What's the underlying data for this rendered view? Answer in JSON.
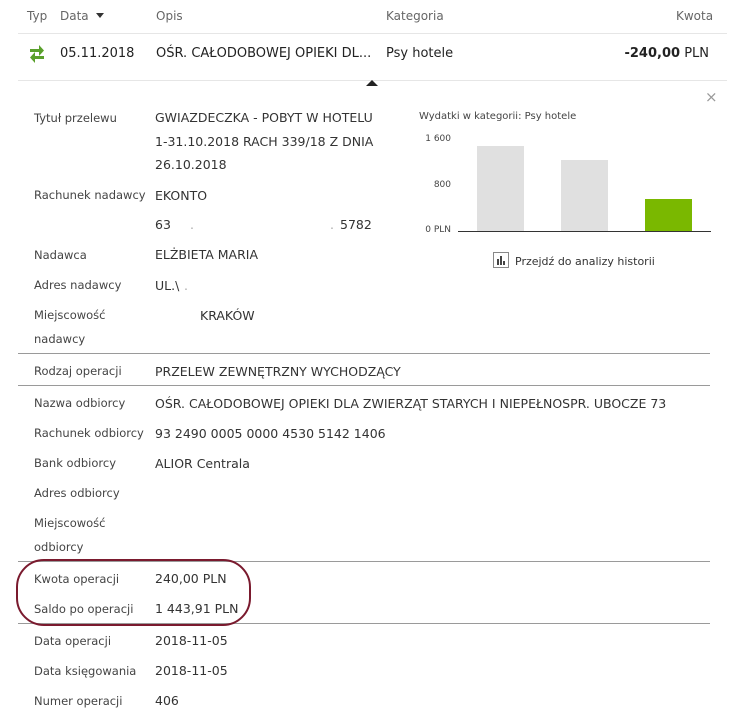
{
  "header": {
    "col_typ": "Typ",
    "col_data": "Data",
    "col_opis": "Opis",
    "col_kategoria": "Kategoria",
    "col_kwota": "Kwota"
  },
  "transaction": {
    "date": "05.11.2018",
    "description": "OŚR. CAŁODOBOWEJ OPIEKI DL...",
    "category": "Psy hotele",
    "amount": "-240,00",
    "currency": "PLN",
    "type_icon": "transfer-arrows-icon"
  },
  "details": {
    "tytul_label": "Tytuł przelewu",
    "tytul_line1": "GWIAZDECZKA - POBYT W HOTELU",
    "tytul_line2": "1-31.10.2018 RACH 339/18 Z DNIA",
    "tytul_line3": "26.10.2018",
    "rachunek_nadawcy_label": "Rachunek nadawcy",
    "rachunek_nadawcy_name": "EKONTO",
    "rachunek_nadawcy_start": "63",
    "rachunek_nadawcy_end": "5782",
    "nadawca_label": "Nadawca",
    "nadawca_value": "ELŻBIETA MARIA",
    "adres_nadawcy_label": "Adres nadawcy",
    "adres_nadawcy_value": "UL.\\",
    "miejscowosc_nadawcy_label1": "Miejscowość",
    "miejscowosc_nadawcy_label2": "nadawcy",
    "miejscowosc_nadawcy_value": "KRAKÓW",
    "rodzaj_label": "Rodzaj operacji",
    "rodzaj_value": "PRZELEW ZEWNĘTRZNY WYCHODZĄCY",
    "nazwa_odbiorcy_label": "Nazwa odbiorcy",
    "nazwa_odbiorcy_value": "OŚR. CAŁODOBOWEJ OPIEKI DLA ZWIERZĄT STARYCH I NIEPEŁNOSPR. UBOCZE 73",
    "rachunek_odbiorcy_label": "Rachunek odbiorcy",
    "rachunek_odbiorcy_value": "93 2490 0005 0000 4530 5142 1406",
    "bank_odbiorcy_label": "Bank odbiorcy",
    "bank_odbiorcy_value": "ALIOR Centrala",
    "adres_odbiorcy_label": "Adres odbiorcy",
    "miejscowosc_odbiorcy_label1": "Miejscowość",
    "miejscowosc_odbiorcy_label2": "odbiorcy",
    "kwota_label": "Kwota operacji",
    "kwota_value": "240,00 PLN",
    "saldo_label": "Saldo po operacji",
    "saldo_value": "1 443,91 PLN",
    "data_operacji_label": "Data operacji",
    "data_operacji_value": "2018-11-05",
    "data_ksiegowania_label": "Data księgowania",
    "data_ksiegowania_value": "2018-11-05",
    "numer_label": "Numer operacji",
    "numer_value": "406"
  },
  "chart_data": {
    "type": "bar",
    "title": "Wydatki w kategorii:",
    "category_name": "Psy hotele",
    "yticks": [
      "1 600",
      "800",
      "0 PLN"
    ],
    "ylim": [
      0,
      1600
    ],
    "values": [
      1490,
      1250,
      560
    ],
    "colors": [
      "#e0e0e0",
      "#e0e0e0",
      "#7ab800"
    ],
    "grid": false
  },
  "history_link": {
    "label": "Przejdź do analizy historii",
    "icon": "bar-chart-icon"
  },
  "close_icon": "close-icon",
  "highlight_color": "#7a1a2e",
  "accent_color": "#7ab800"
}
